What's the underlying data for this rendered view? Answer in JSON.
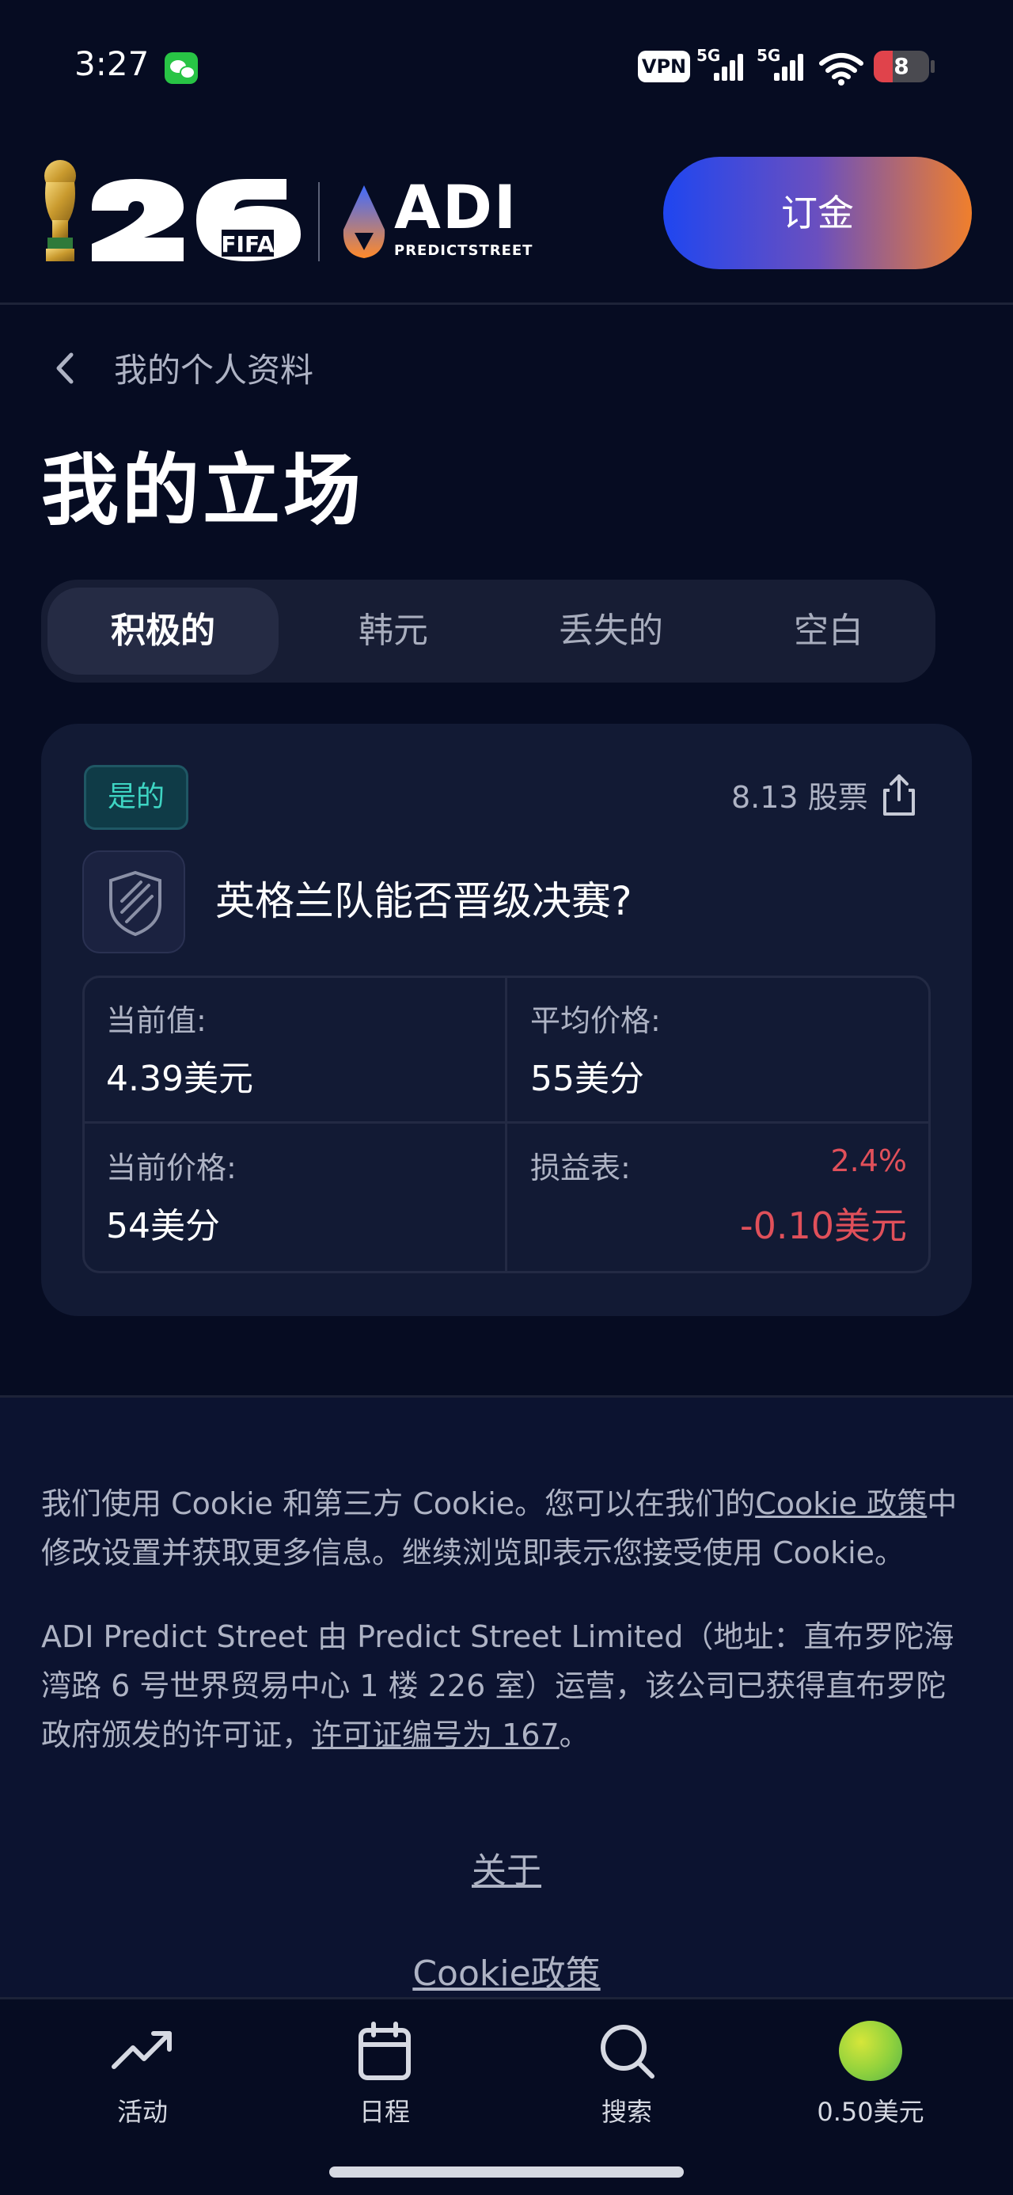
{
  "status_bar": {
    "time": "3:27",
    "vpn": "VPN",
    "network_1": "5G",
    "network_2": "5G",
    "battery": "8"
  },
  "header": {
    "fifa_mark": "FIFA",
    "brand": "ADI",
    "brand_sub": "PREDICTSTREET",
    "deposit_label": "订金"
  },
  "breadcrumb": {
    "label": "我的个人资料"
  },
  "page_title": "我的立场",
  "tabs": [
    {
      "label": "积极的",
      "active": true
    },
    {
      "label": "韩元",
      "active": false
    },
    {
      "label": "丢失的",
      "active": false
    },
    {
      "label": "空白",
      "active": false
    }
  ],
  "position": {
    "side_badge": "是的",
    "shares": "8.13 股票",
    "market_title": "英格兰队能否晋级决赛?",
    "current_value_label": "当前值:",
    "current_value": "4.39美元",
    "avg_price_label": "平均价格:",
    "avg_price": "55美分",
    "current_price_label": "当前价格:",
    "current_price": "54美分",
    "pnl_label": "损益表:",
    "pnl_percent": "2.4%",
    "pnl_value": "-0.10美元",
    "colors": {
      "loss": "#e0505a",
      "yes": "#3ed5c3"
    }
  },
  "footer": {
    "cookie_text_1": "我们使用 Cookie 和第三方 Cookie。您可以在我们的",
    "cookie_link": "Cookie 政策",
    "cookie_text_2": "中修改设置并获取更多信息。继续浏览即表示您接受使用 Cookie。",
    "legal_text_1": "ADI Predict Street 由 Predict Street Limited（地址：直布罗陀海湾路 6 号世界贸易中心 1 楼 226 室）运营，该公司已获得直布罗陀政府颁发的许可证，",
    "license_link": "许可证编号为 167",
    "legal_text_2": "。",
    "about_link": "关于",
    "cookie_policy_link": "Cookie政策"
  },
  "bottom_nav": [
    {
      "label": "活动",
      "icon": "trending-up-icon"
    },
    {
      "label": "日程",
      "icon": "calendar-icon"
    },
    {
      "label": "搜索",
      "icon": "search-icon"
    },
    {
      "label": "0.50美元",
      "icon": "avatar"
    }
  ]
}
